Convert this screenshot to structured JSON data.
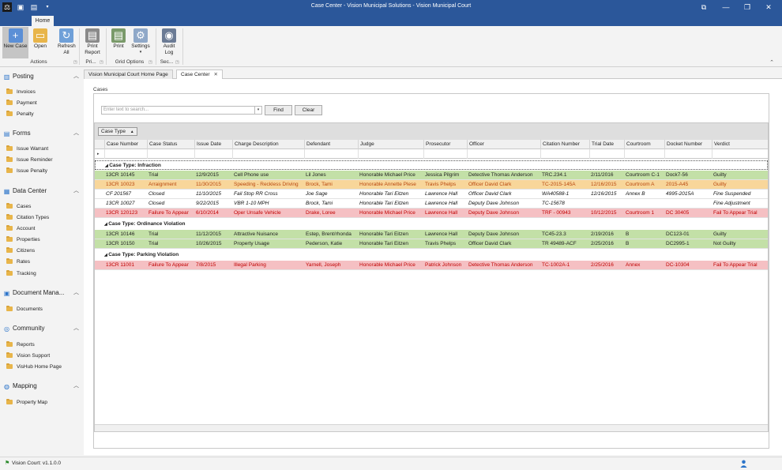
{
  "window": {
    "title": "Case Center - Vision Municipal Solutions - Vision Municipal Court",
    "ribbon_tab": "Home"
  },
  "ribbon": {
    "buttons": [
      {
        "label": "New Case",
        "icon": "new-case-icon"
      },
      {
        "label": "Open",
        "icon": "folder-open-icon"
      },
      {
        "label": "Refresh All",
        "icon": "refresh-icon"
      },
      {
        "label": "Print Report",
        "icon": "printer-icon"
      },
      {
        "label": "Print",
        "icon": "print-grid-icon"
      },
      {
        "label": "Settings",
        "icon": "settings-icon"
      },
      {
        "label": "Audit Log",
        "icon": "audit-log-icon"
      }
    ],
    "groups": [
      "Actions",
      "Pri...",
      "Grid Options",
      "Sec..."
    ]
  },
  "nav": {
    "sections": [
      {
        "title": "Posting",
        "items": [
          "Invoices",
          "Payment",
          "Penalty"
        ]
      },
      {
        "title": "Forms",
        "items": [
          "Issue Warrant",
          "Issue Reminder",
          "Issue Penalty"
        ]
      },
      {
        "title": "Data Center",
        "items": [
          "Cases",
          "Citation Types",
          "Account",
          "Properties",
          "Citizens",
          "Rates",
          "Tracking"
        ]
      },
      {
        "title": "Document Mana...",
        "items": [
          "Documents"
        ]
      },
      {
        "title": "Community",
        "items": [
          "Reports",
          "Vision Support",
          "VisHub Home Page"
        ]
      },
      {
        "title": "Mapping",
        "items": [
          "Property Map"
        ]
      }
    ]
  },
  "doc_tabs": [
    "Vision Municipal Court Home Page",
    "Case Center"
  ],
  "cases": {
    "group_label": "Cases",
    "search_placeholder": "Enter text to search...",
    "find_label": "Find",
    "clear_label": "Clear",
    "group_by_chip": "Case Type",
    "columns": [
      "Case Number",
      "Case Status",
      "Issue Date",
      "Charge Description",
      "Defendant",
      "Judge",
      "Prosecutor",
      "Officer",
      "Citation Number",
      "Trial Date",
      "Courtroom",
      "Docket Number",
      "Verdict"
    ],
    "groups": [
      {
        "title": "Case Type: Infraction",
        "rows": [
          {
            "style": "green",
            "cells": [
              "13CR 10145",
              "Trial",
              "12/9/2015",
              "Cell Phone use",
              "Lil Jones",
              "Honorable Michael Price",
              "Jessica Pilgrim",
              "Detective Thomas Anderson",
              "TRC.234.1",
              "2/11/2016",
              "Courtroom C-1",
              "Dock7-56",
              "Guilty"
            ]
          },
          {
            "style": "orange",
            "cells": [
              "13CR 10023",
              "Arraignment",
              "11/30/2015",
              "Speeding - Reckless Driving",
              "Brock, Tami",
              "Honorable Annette Plese",
              "Travis Phelps",
              "Officer David Clark",
              "TC-2015-145A",
              "12/16/2015",
              "Courtroom A",
              "2015-A45",
              "Guilty"
            ]
          },
          {
            "style": "white",
            "cells": [
              "CF 201567",
              "Closed",
              "11/10/2015",
              "Fail Stop RR Cross",
              "Joe Sage",
              "Honorable Tari Eitzen",
              "Lawrence Hall",
              "Officer David Clark",
              "WA40588-1",
              "12/16/2015",
              "Annex B",
              "4995-2015A",
              "Fine Suspended"
            ]
          },
          {
            "style": "white",
            "cells": [
              "13CR 10027",
              "Closed",
              "9/22/2015",
              "VBR 1-10 MPH",
              "Brock, Tami",
              "Honorable Tari Eitzen",
              "Lawrence Hall",
              "Deputy Dave Johnson",
              "TC-15678",
              "",
              "",
              "",
              "Fine Adjustment"
            ]
          },
          {
            "style": "red",
            "cells": [
              "13CR 120123",
              "Failure To Appear",
              "6/10/2014",
              "Oper Unsafe Vehicle",
              "Drake, Loree",
              "Honorable Michael Price",
              "Lawrence Hall",
              "Deputy Dave Johnson",
              "TRF - 00943",
              "10/12/2015",
              "Courtroom 1",
              "DC 30405",
              "Fail To Appear Trial"
            ]
          }
        ]
      },
      {
        "title": "Case Type: Ordinance Violation",
        "rows": [
          {
            "style": "green",
            "cells": [
              "13CR 10146",
              "Trial",
              "11/12/2015",
              "Attractive Nuisance",
              "Estep, Brent/rhonda",
              "Honorable Tari Eitzen",
              "Lawrence Hall",
              "Deputy Dave Johnson",
              "TC45-23.3",
              "2/19/2016",
              "B",
              "DC123-01",
              "Guilty"
            ]
          },
          {
            "style": "green",
            "cells": [
              "13CR 10150",
              "Trial",
              "10/26/2015",
              "Property Usage",
              "Pederson, Katie",
              "Honorable Tari Eitzen",
              "Travis Phelps",
              "Officer David Clark",
              "TR 49489-ACF",
              "2/25/2016",
              "B",
              "DC2995-1",
              "Not Guilty"
            ]
          }
        ]
      },
      {
        "title": "Case Type: Parking Violation",
        "rows": [
          {
            "style": "red",
            "cells": [
              "13CR 11001",
              "Failure To Appear",
              "7/8/2015",
              "Illegal Parking",
              "Yarnell, Joseph",
              "Honorable Michael Price",
              "Patrick Johnson",
              "Detective Thomas Anderson",
              "TC-1002A-1",
              "2/25/2016",
              "Annex",
              "DC-10304",
              "Fail To Appear Trial"
            ]
          }
        ]
      }
    ]
  },
  "status": {
    "version": "Vision Court: v1.1.0.0"
  }
}
